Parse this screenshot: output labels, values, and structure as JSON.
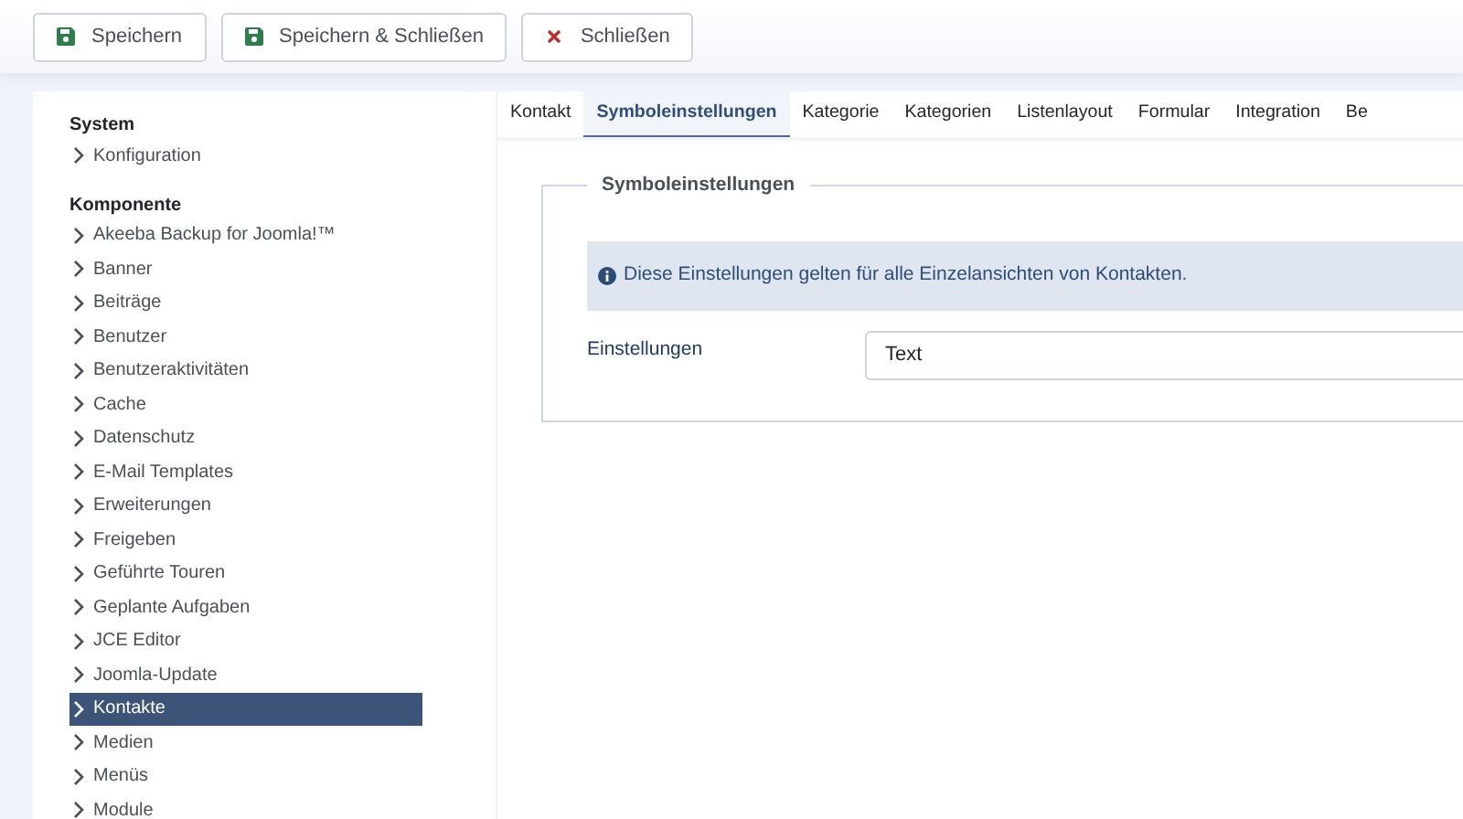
{
  "toolbar": [
    {
      "label": "Speichern",
      "kind": "save"
    },
    {
      "label": "Speichern & Schließen",
      "kind": "save"
    },
    {
      "label": "Schließen",
      "kind": "close"
    }
  ],
  "sidebar": [
    {
      "heading": "System",
      "items": [
        {
          "label": "Konfiguration",
          "selected": false
        }
      ]
    },
    {
      "heading": "Komponente",
      "items": [
        {
          "label": "Akeeba Backup for Joomla!™",
          "selected": false
        },
        {
          "label": "Banner",
          "selected": false
        },
        {
          "label": "Beiträge",
          "selected": false
        },
        {
          "label": "Benutzer",
          "selected": false
        },
        {
          "label": "Benutzeraktivitäten",
          "selected": false
        },
        {
          "label": "Cache",
          "selected": false
        },
        {
          "label": "Datenschutz",
          "selected": false
        },
        {
          "label": "E-Mail Templates",
          "selected": false
        },
        {
          "label": "Erweiterungen",
          "selected": false
        },
        {
          "label": "Freigeben",
          "selected": false
        },
        {
          "label": "Geführte Touren",
          "selected": false
        },
        {
          "label": "Geplante Aufgaben",
          "selected": false
        },
        {
          "label": "JCE Editor",
          "selected": false
        },
        {
          "label": "Joomla-Update",
          "selected": false
        },
        {
          "label": "Kontakte",
          "selected": true
        },
        {
          "label": "Medien",
          "selected": false
        },
        {
          "label": "Menüs",
          "selected": false
        },
        {
          "label": "Module",
          "selected": false
        }
      ]
    }
  ],
  "tabs": [
    {
      "label": "Kontakt",
      "selected": false
    },
    {
      "label": "Symboleinstellungen",
      "selected": true
    },
    {
      "label": "Kategorie",
      "selected": false
    },
    {
      "label": "Kategorien",
      "selected": false
    },
    {
      "label": "Listenlayout",
      "selected": false
    },
    {
      "label": "Formular",
      "selected": false
    },
    {
      "label": "Integration",
      "selected": false
    },
    {
      "label": "Be",
      "selected": false
    }
  ],
  "fieldset": {
    "legend": "Symboleinstellungen",
    "alert": "Diese Einstellungen gelten für alle Einzelansichten von Kontakten.",
    "fields": [
      {
        "label": "Einstellungen",
        "value": "Text"
      }
    ]
  }
}
